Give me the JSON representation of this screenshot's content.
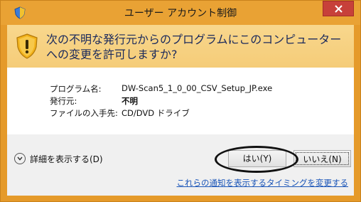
{
  "window": {
    "title": "ユーザー アカウント制御"
  },
  "header": {
    "message": "次の不明な発行元からのプログラムにこのコンピューターへの変更を許可しますか?"
  },
  "info": {
    "program_label": "プログラム名:",
    "program_value": "DW-Scan5_1_0_00_CSV_Setup_JP.exe",
    "publisher_label": "発行元:",
    "publisher_value": "不明",
    "source_label": "ファイルの入手先:",
    "source_value": "CD/DVD ドライブ"
  },
  "footer": {
    "details_label": "詳細を表示する(D)",
    "yes_label": "はい(Y)",
    "no_label": "いいえ(N)",
    "notify_link": "これらの通知を表示するタイミングを変更する"
  },
  "colors": {
    "title_bar": "#e9a234",
    "header_band": "#f7d283",
    "close_button": "#c7403a",
    "link": "#1a55b8"
  },
  "icons": {
    "title": "uac-shield-icon",
    "warning": "warning-shield-icon",
    "close": "close-icon",
    "details": "chevron-down-icon"
  }
}
